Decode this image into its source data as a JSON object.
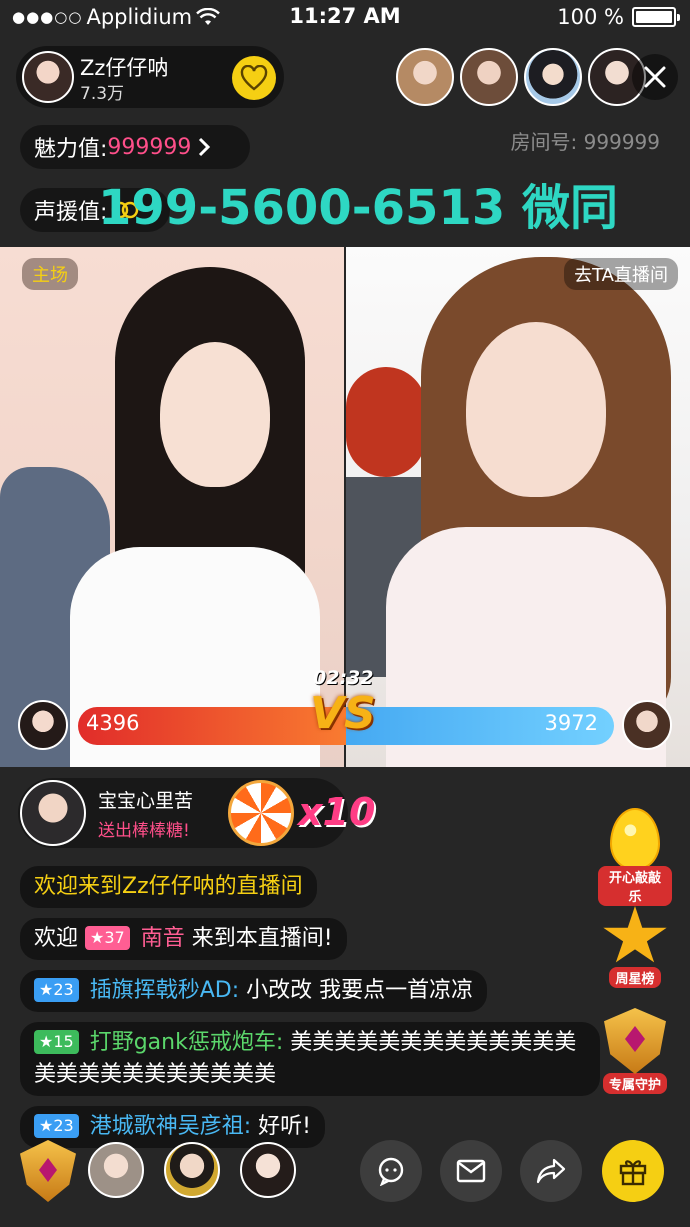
{
  "status_bar": {
    "signal": "●●●○○",
    "carrier": "Applidium",
    "time": "11:27 AM",
    "battery": "100 %"
  },
  "host": {
    "name": "Zz仔仔呐",
    "followers": "7.3万"
  },
  "charm": {
    "label": "魅力值:",
    "value": "999999"
  },
  "support": {
    "label": "声援值:"
  },
  "room": {
    "label": "房间号: 999999"
  },
  "watermark": "199-5600-6513 微同",
  "pk": {
    "left_tag": "主场",
    "right_tag": "去TA直播间",
    "timer": "02:32",
    "vs": "VS",
    "left_score": "4396",
    "right_score": "3972"
  },
  "gift": {
    "sender": "宝宝心里苦",
    "action": "送出棒棒糖!",
    "count": "x10"
  },
  "chat": {
    "welcome": "欢迎来到Zz仔仔呐的直播间",
    "m1": {
      "prefix": "欢迎",
      "level": "★37",
      "user": "南音",
      "text": "来到本直播间!"
    },
    "m2": {
      "level": "★23",
      "user": "插旗挥戟秒AD:",
      "text": "小改改 我要点一首凉凉"
    },
    "m3": {
      "level": "★15",
      "user": "打野gank惩戒炮车:",
      "text": "美美美美美美美美美美美美美美美美美美美美美美美美"
    },
    "m4": {
      "level": "★23",
      "user": "港城歌神吴彦祖:",
      "text": "好听!"
    }
  },
  "badges": {
    "happy": "开心敲敲乐",
    "weekly": "周星榜",
    "guard": "专属守护"
  },
  "colors": {
    "accent_yellow": "#f5cf13",
    "pink": "#ff4f8a",
    "teal_watermark": "#2ed7c3",
    "pk_red": "#e12c2a",
    "pk_blue": "#45a9f2"
  }
}
